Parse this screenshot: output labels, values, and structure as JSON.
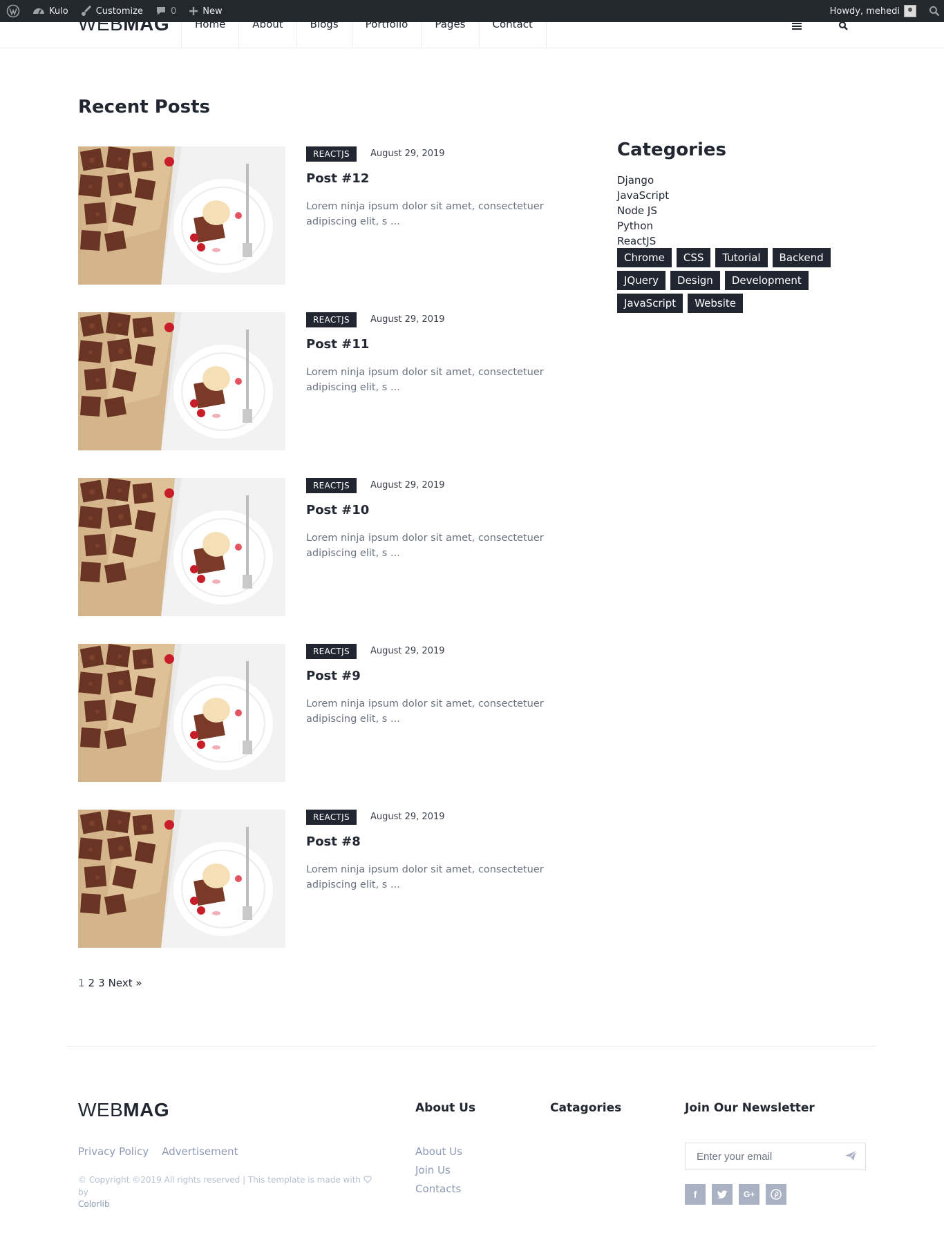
{
  "adminbar": {
    "site_name": "Kulo",
    "customize": "Customize",
    "comments_count": "0",
    "new_label": "New",
    "howdy": "Howdy, mehedi"
  },
  "header": {
    "logo_light": "WEB",
    "logo_bold": "MAG",
    "nav": [
      "Home",
      "About",
      "Blogs",
      "Portfolio",
      "Pages",
      "Contact"
    ]
  },
  "main": {
    "section_title": "Recent Posts",
    "posts": [
      {
        "category": "REACTJS",
        "date": "August 29, 2019",
        "title": "Post #12",
        "excerpt": "Lorem ninja ipsum dolor sit amet, consectetuer adipiscing elit, s ..."
      },
      {
        "category": "REACTJS",
        "date": "August 29, 2019",
        "title": "Post #11",
        "excerpt": "Lorem ninja ipsum dolor sit amet, consectetuer adipiscing elit, s ..."
      },
      {
        "category": "REACTJS",
        "date": "August 29, 2019",
        "title": "Post #10",
        "excerpt": "Lorem ninja ipsum dolor sit amet, consectetuer adipiscing elit, s ..."
      },
      {
        "category": "REACTJS",
        "date": "August 29, 2019",
        "title": "Post #9",
        "excerpt": "Lorem ninja ipsum dolor sit amet, consectetuer adipiscing elit, s ..."
      },
      {
        "category": "REACTJS",
        "date": "August 29, 2019",
        "title": "Post #8",
        "excerpt": "Lorem ninja ipsum dolor sit amet, consectetuer adipiscing elit, s ..."
      }
    ],
    "pagination": {
      "current": "1",
      "pages": [
        "2",
        "3"
      ],
      "next": "Next »"
    }
  },
  "sidebar": {
    "title": "Categories",
    "categories": [
      "Django",
      "JavaScript",
      "Node JS",
      "Python",
      "ReactJS"
    ],
    "tags": [
      "Chrome",
      "CSS",
      "Tutorial",
      "Backend",
      "JQuery",
      "Design",
      "Development",
      "JavaScript",
      "Website"
    ]
  },
  "footer": {
    "logo_light": "WEB",
    "logo_bold": "MAG",
    "links": [
      "Privacy Policy",
      "Advertisement"
    ],
    "copyright_text": "© Copyright ©2019 All rights reserved | This template is made with",
    "copyright_by": "by",
    "copyright_brand": "Colorlib",
    "about_heading": "About Us",
    "about_links": [
      "About Us",
      "Join Us",
      "Contacts"
    ],
    "categories_heading": "Catagories",
    "newsletter_heading": "Join Our Newsletter",
    "newsletter_placeholder": "Enter your email",
    "socials": [
      "facebook-icon",
      "twitter-icon",
      "google-plus-icon",
      "pinterest-icon"
    ]
  },
  "colors": {
    "dark": "#212631",
    "muted": "#8e9ab3",
    "adminbar": "#23282d"
  }
}
